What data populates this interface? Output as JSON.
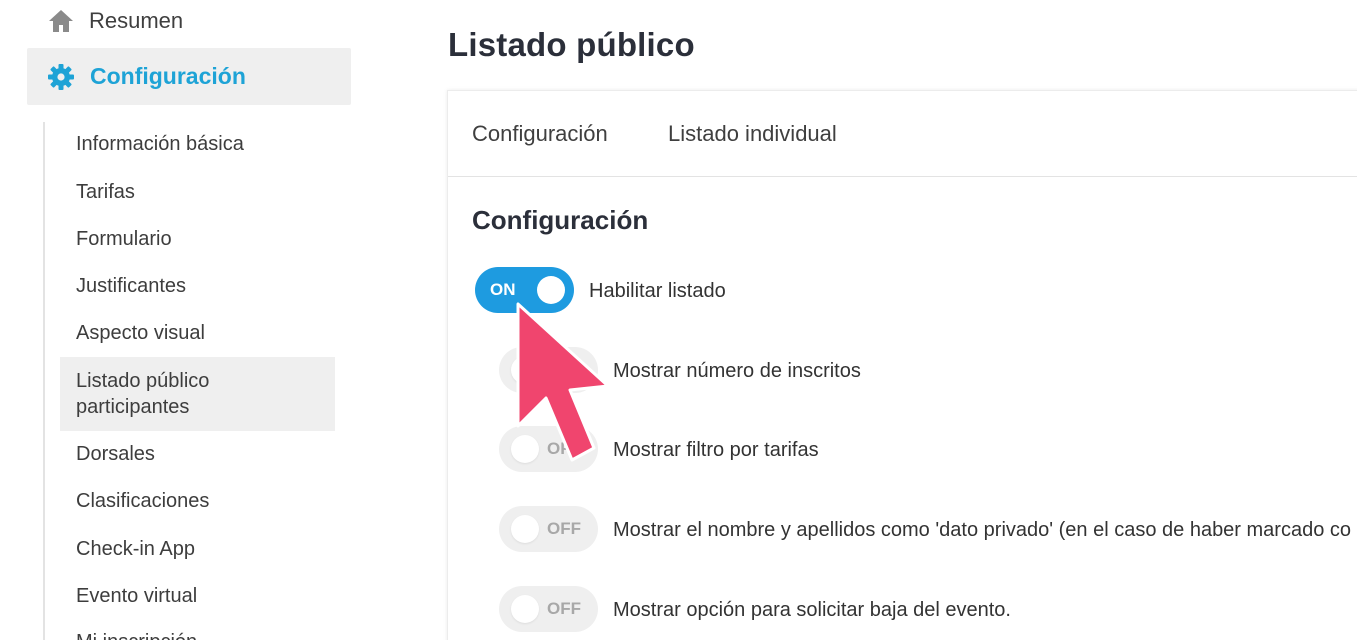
{
  "sidebar": {
    "top_item": {
      "label": "Resumen",
      "icon": "home-icon"
    },
    "active_item": {
      "label": "Configuración",
      "icon": "gear-icon",
      "color": "#1ea3d6"
    },
    "subitems": [
      "Información básica",
      "Tarifas",
      "Formulario",
      "Justificantes",
      "Aspecto visual",
      "Listado público participantes",
      "Dorsales",
      "Clasificaciones",
      "Check-in App",
      "Evento virtual",
      "Mi inscripción"
    ]
  },
  "main": {
    "title": "Listado público",
    "tabs": [
      "Configuración",
      "Listado individual"
    ],
    "section_title": "Configuración",
    "options": [
      {
        "state": "ON",
        "label": "Habilitar listado"
      },
      {
        "state": "OFF",
        "label": "Mostrar número de inscritos"
      },
      {
        "state": "OFF",
        "label": "Mostrar filtro por tarifas"
      },
      {
        "state": "OFF",
        "label": "Mostrar el nombre y apellidos como 'dato privado' (en el caso de haber marcado co"
      },
      {
        "state": "OFF",
        "label": "Mostrar opción para solicitar baja del evento."
      }
    ]
  },
  "colors": {
    "accent": "#1e9be0",
    "cursor": "#f0456e"
  }
}
